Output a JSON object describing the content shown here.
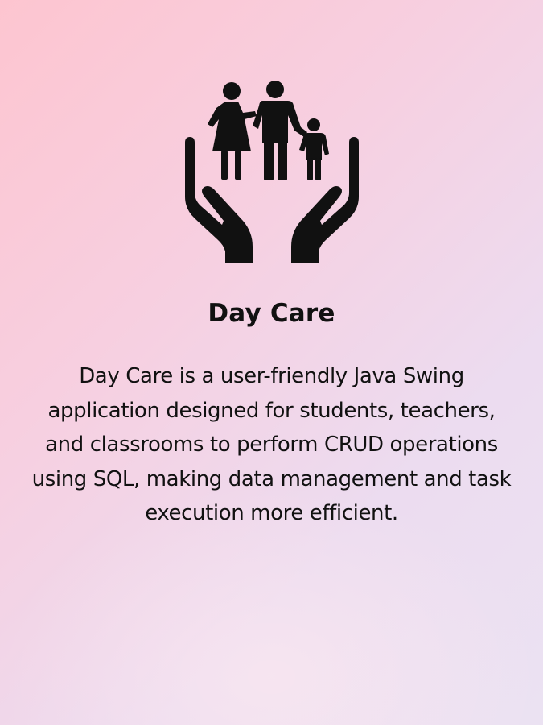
{
  "card": {
    "title": "Day Care",
    "description_lines": [
      "Day Care is a user-friendly Java Swing",
      "application designed for students, teachers,",
      "and classrooms to perform CRUD operations",
      "using SQL, making data management and task",
      "execution more efficient."
    ]
  },
  "logo": {
    "icon": "family-in-hands-icon",
    "color": "#111111"
  },
  "theme": {
    "gradient_start": "#fdc5d0",
    "gradient_end": "#ebe2f2",
    "text_color": "#111111"
  }
}
